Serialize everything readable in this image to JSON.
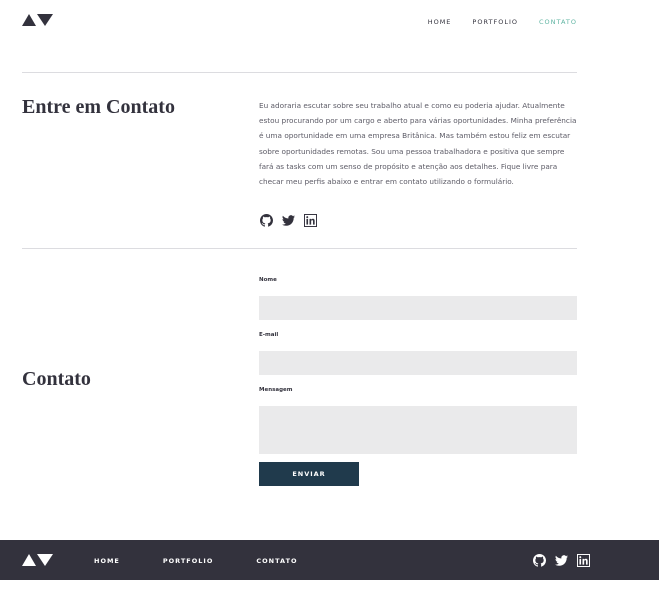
{
  "header": {
    "nav": [
      {
        "label": "HOME"
      },
      {
        "label": "PORTFOLIO"
      },
      {
        "label": "CONTATO"
      }
    ]
  },
  "about": {
    "title": "Entre em Contato",
    "text": "Eu adoraria escutar sobre seu trabalho atual e como eu poderia ajudar. Atualmente estou procurando por um cargo e aberto para várias oportunidades. Minha preferência é uma oportunidade em uma empresa Britânica. Mas também estou feliz em escutar sobre oportunidades remotas. Sou uma pessoa trabalhadora e positiva que sempre fará as tasks com um senso de propósito e atenção aos detalhes. Fique livre para checar meu perfis abaixo e entrar em contato utilizando o formulário.",
    "social": [
      "github-icon",
      "twitter-icon",
      "linkedin-icon"
    ]
  },
  "contact": {
    "title": "Contato",
    "name_label": "Nome",
    "name_value": "",
    "email_label": "E-mail",
    "email_value": "",
    "message_label": "Mensagem",
    "message_value": "",
    "submit_label": "ENVIAR"
  },
  "footer": {
    "nav": [
      {
        "label": "HOME"
      },
      {
        "label": "PORTFOLIO"
      },
      {
        "label": "CONTATO"
      }
    ],
    "social": [
      "github-icon",
      "twitter-icon",
      "linkedin-icon"
    ]
  },
  "colors": {
    "primary_dark": "#33323d",
    "accent": "#5fb4a2",
    "button": "#203a4c",
    "field_bg": "#eaeaeb"
  }
}
